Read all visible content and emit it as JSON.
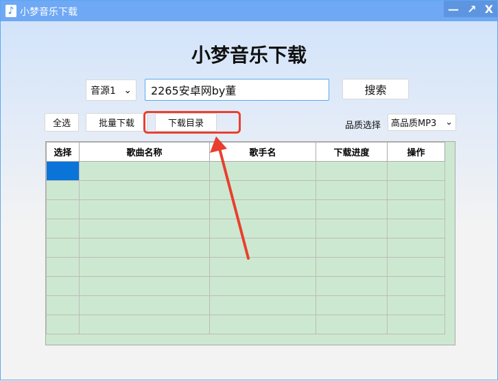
{
  "window": {
    "title": "小梦音乐下载",
    "controls": [
      "—",
      "↗",
      "X"
    ]
  },
  "heading": "小梦音乐下载",
  "source_select": {
    "value": "音源1"
  },
  "search_input": {
    "value": "2265安卓网by董"
  },
  "search_button": "搜索",
  "select_all_button": "全选",
  "batch_download_button": "批量下载",
  "download_dir_button": "下载目录",
  "quality_label": "品质选择",
  "quality_select": {
    "value": "高品质MP3"
  },
  "table": {
    "columns": [
      "选择",
      "歌曲名称",
      "歌手名",
      "下载进度",
      "操作"
    ],
    "row_count": 9,
    "selected_cell_row": 0
  },
  "colors": {
    "titlebar": "#6fa8f5",
    "grid_bg": "#cde8d0",
    "annotation": "#e8402f",
    "selection": "#0a74d8"
  }
}
